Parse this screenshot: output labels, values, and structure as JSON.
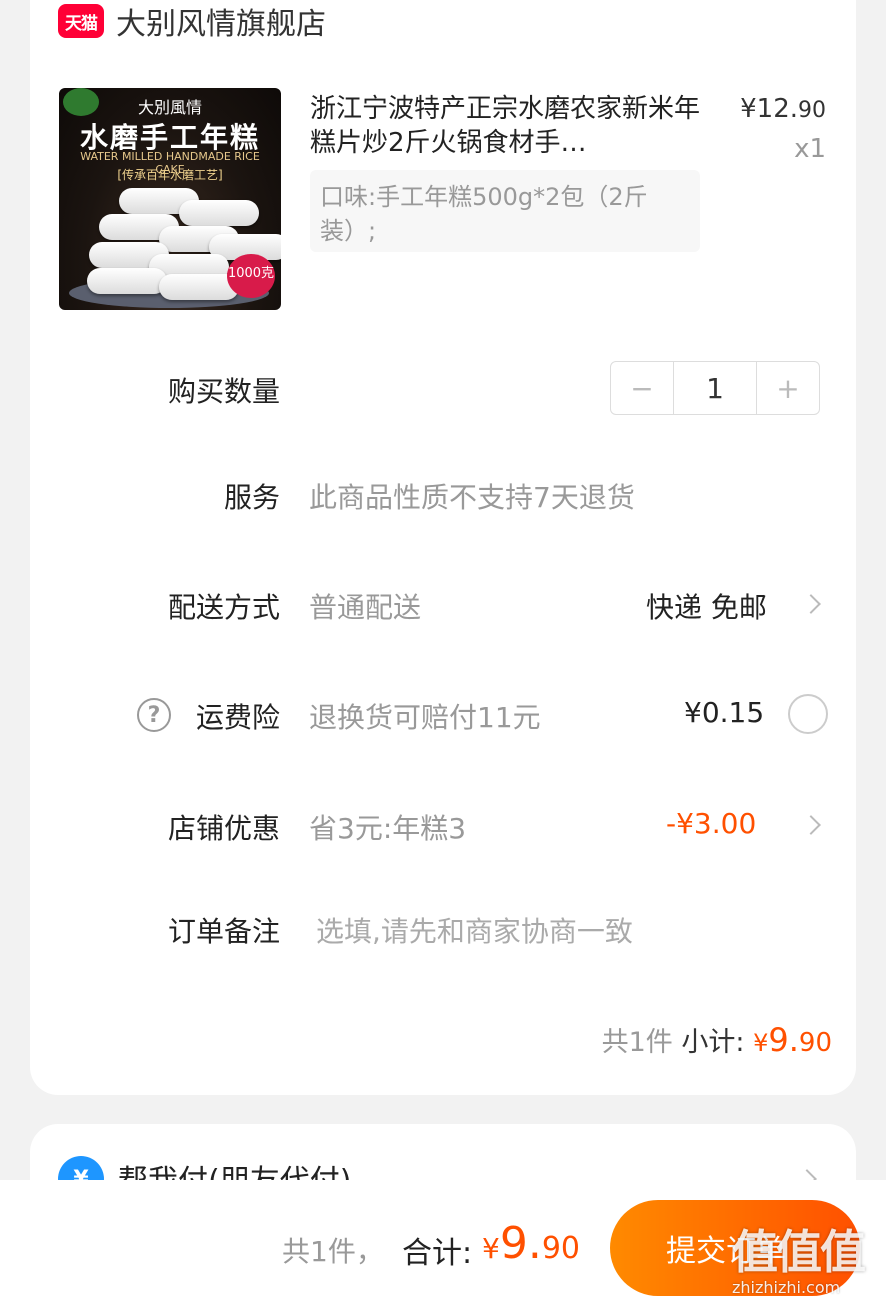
{
  "shop": {
    "badge": "天猫",
    "name": "大别风情旗舰店"
  },
  "product": {
    "thumbnail": {
      "brand": "大別風情",
      "title": "水磨手工年糕",
      "subtitle": "WATER MILLED HANDMADE RICE CAKE",
      "tagline": "[传承百年水磨工艺]",
      "badge": "1000克"
    },
    "title": "浙江宁波特产正宗水磨农家新米年糕片炒2斤火锅食材手…",
    "sku": "口味:手工年糕500g*2包（2斤装）;",
    "price_yen": "¥12.",
    "price_cents": "90",
    "quantity_label": "x1"
  },
  "rows": {
    "quantity": {
      "label": "购买数量",
      "value": "1",
      "minus": "−",
      "plus": "+"
    },
    "service": {
      "label": "服务",
      "value": "此商品性质不支持7天退货"
    },
    "delivery": {
      "label": "配送方式",
      "value": "普通配送",
      "right": "快递 免邮"
    },
    "insurance": {
      "label": "运费险",
      "value": "退换货可赔付11元",
      "right": "¥0.15",
      "help": "?"
    },
    "discount": {
      "label": "店铺优惠",
      "value": "省3元:年糕3",
      "right": "-¥3.00"
    },
    "note": {
      "label": "订单备注",
      "placeholder": "选填,请先和商家协商一致"
    }
  },
  "subtotal": {
    "count": "共1件",
    "label": "小计:",
    "yen": "¥",
    "amount": "9.",
    "cents": "90"
  },
  "pay_for_me": {
    "icon": "¥",
    "label": "帮我付(朋友代付)"
  },
  "footer": {
    "count": "共1件，",
    "total_label": "合计:",
    "yen": "¥",
    "amount": "9.",
    "cents": "90",
    "submit": "提交订单"
  },
  "watermark": {
    "mark": "值值值",
    "url": "zhizhizhi.com"
  },
  "colors": {
    "accent": "#ff5000",
    "tmall": "#ff0036",
    "alipay": "#1e96ff"
  }
}
